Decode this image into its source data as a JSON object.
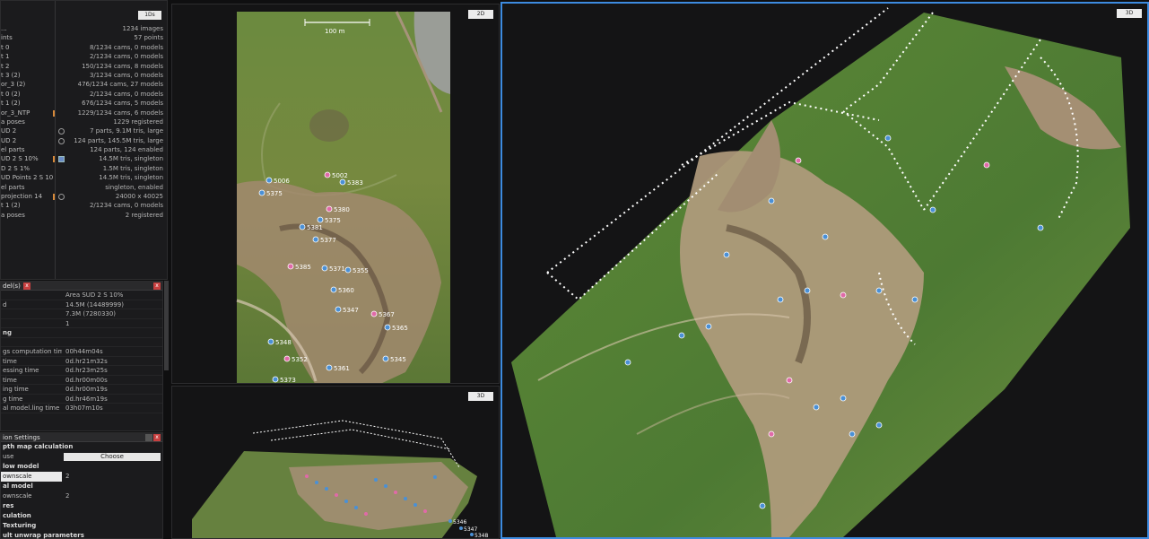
{
  "top_panel": {
    "tag": "1Ds",
    "rows": [
      {
        "name": "...",
        "value": "1234 images"
      },
      {
        "name": "ints",
        "value": "57 points"
      },
      {
        "name": "t 0",
        "value": "8/1234 cams, 0 models"
      },
      {
        "name": "t 1",
        "value": "2/1234 cams, 0 models"
      },
      {
        "name": "t 2",
        "value": "150/1234 cams, 8 models"
      },
      {
        "name": "t 3 (2)",
        "value": "3/1234 cams, 0 models"
      },
      {
        "name": "or_3 (2)",
        "value": "476/1234 cams, 27 models"
      },
      {
        "name": "t 0 (2)",
        "value": "2/1234 cams, 0 models"
      },
      {
        "name": "t 1 (2)",
        "value": "676/1234 cams, 5 models"
      },
      {
        "name": "or_3_NTP",
        "value": "1229/1234 cams, 6 models"
      },
      {
        "name": "a poses",
        "value": "1229 registered"
      },
      {
        "name": "UD 2",
        "value": "7 parts, 9.1M tris, large"
      },
      {
        "name": "UD 2",
        "value": "124 parts, 145.5M tris, large"
      },
      {
        "name": "el parts",
        "value": "124 parts, 124 enabled"
      },
      {
        "name": "UD 2 S 10%",
        "value": "14.5M tris, singleton"
      },
      {
        "name": "D 2 S 1%",
        "value": "1.5M tris, singleton"
      },
      {
        "name": "UD Points 2 S 10",
        "value": "14.5M tris, singleton"
      },
      {
        "name": "el parts",
        "value": "singleton, enabled"
      },
      {
        "name": "projection 14",
        "value": "24000 x 40025"
      },
      {
        "name": "t 1 (2)",
        "value": "2/1234 cams, 0 models"
      },
      {
        "name": "a poses",
        "value": "2 registered"
      }
    ]
  },
  "model_panel": {
    "title": "del(s)",
    "rows": [
      {
        "key": "",
        "value": "Area SUD 2 S 10%"
      },
      {
        "key": "d",
        "value": "14.5M (14489999)"
      },
      {
        "key": "",
        "value": "7.3M (7280330)"
      },
      {
        "key": "",
        "value": "1"
      },
      {
        "key": "ng",
        "value": "",
        "section": true
      },
      {
        "key": "",
        "value": ""
      },
      {
        "key": "gs computation time",
        "value": "00h44m04s"
      },
      {
        "key": "time",
        "value": "0d.hr21m32s"
      },
      {
        "key": "essing time",
        "value": "0d.hr23m25s"
      },
      {
        "key": "time",
        "value": "0d.hr00m00s"
      },
      {
        "key": "ing time",
        "value": "0d.hr00m19s"
      },
      {
        "key": "g time",
        "value": "0d.hr46m19s"
      },
      {
        "key": "al model.ling time",
        "value": "03h07m10s"
      }
    ]
  },
  "settings_panel": {
    "title": "ion Settings",
    "depth_section": "pth map calculation",
    "use_label": "use",
    "choose_label": "Choose",
    "flow_model": "low model",
    "downscale_label": "ownscale",
    "downscale_value": "2",
    "final_model": "al model",
    "downscale2_label": "ownscale",
    "downscale2_value": "2",
    "items": [
      "res",
      "culation",
      "Texturing",
      "ult unwrap parameters"
    ]
  },
  "viewports": {
    "top_2d_tag": "2D",
    "small_3d_tag": "3D",
    "main_3d_tag": "3D",
    "scale_label": "100 m"
  },
  "markers_2d": [
    "5002",
    "5006",
    "5383",
    "5375",
    "5380",
    "5375",
    "5381",
    "5377",
    "5385",
    "5371",
    "5355",
    "5360",
    "5367",
    "5365",
    "5347",
    "5348",
    "5352",
    "5361",
    "5345",
    "5373"
  ],
  "markers_small": [
    "5346",
    "5347",
    "5348"
  ],
  "colors": {
    "accent": "#3d8bdf",
    "panel_bg": "#1b1b1d",
    "viewport_bg": "#141415",
    "close": "#c84040"
  }
}
